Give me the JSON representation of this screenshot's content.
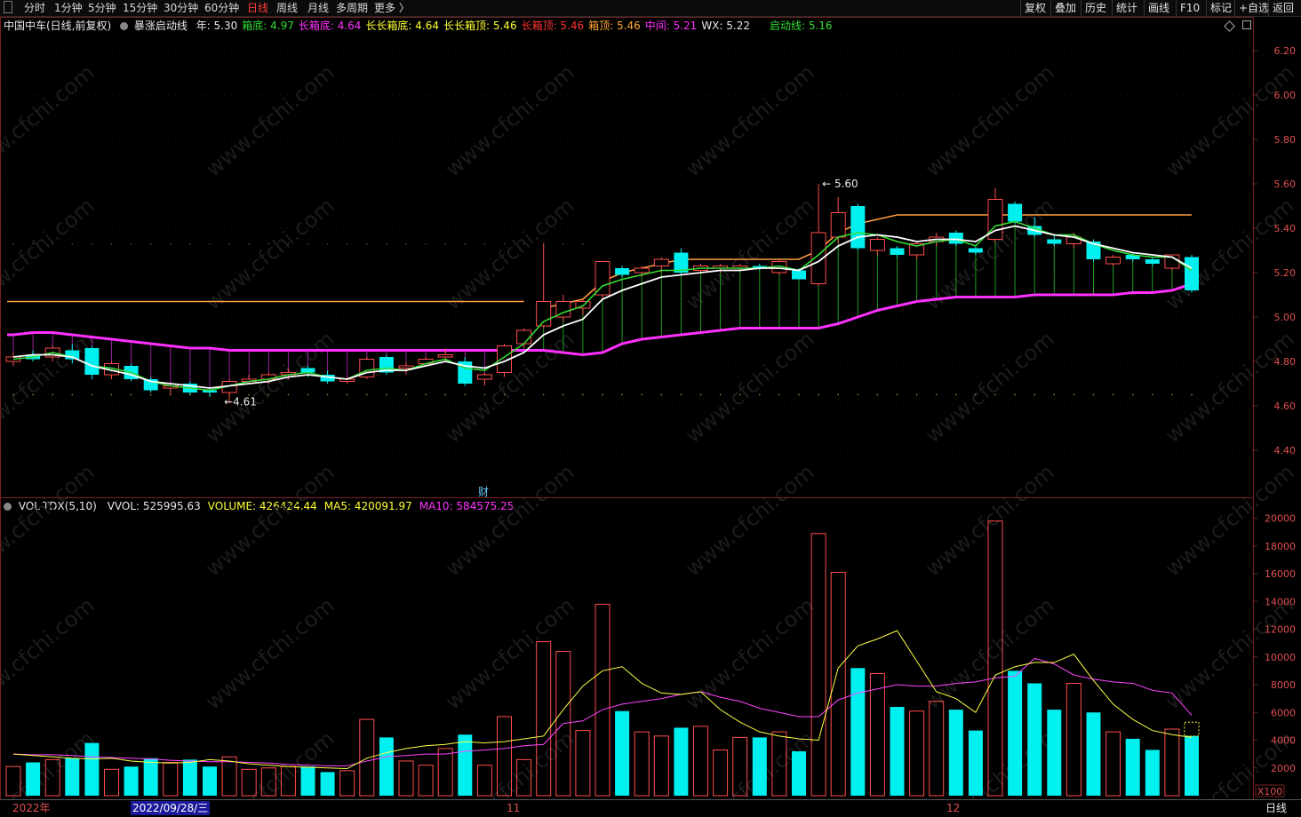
{
  "toolbar": {
    "periods": [
      "分时",
      "1分钟",
      "5分钟",
      "15分钟",
      "30分钟",
      "60分钟",
      "日线",
      "周线",
      "月线",
      "多周期",
      "更多 〉"
    ],
    "active_period": "日线",
    "right_buttons": [
      "复权",
      "叠加",
      "历史",
      "统计",
      "画线",
      "F10",
      "标记",
      "+自选",
      "返回"
    ]
  },
  "main_legend": {
    "title": "中国中车(日线,前复权)",
    "indicator": "暴涨启动线",
    "items": [
      {
        "label": "年: 5.30",
        "color": "#e8e8e8"
      },
      {
        "label": "箱底: 4.97",
        "color": "#33dd33"
      },
      {
        "label": "长箱底: 4.64",
        "color": "#ff33ff"
      },
      {
        "label": "长长箱底: 4.64",
        "color": "#ffff33"
      },
      {
        "label": "长长箱顶: 5.46",
        "color": "#ffff33"
      },
      {
        "label": "长箱顶: 5.46",
        "color": "#ff3333"
      },
      {
        "label": "箱顶: 5.46",
        "color": "#ffaa33"
      },
      {
        "label": "中间: 5.21",
        "color": "#ff33ff"
      },
      {
        "label": "WX: 5.22",
        "color": "#e8e8e8"
      },
      {
        "label": "启动线: 5.16",
        "color": "#33dd33"
      }
    ]
  },
  "vol_legend": {
    "title": "VOL-TDX(5,10)",
    "items": [
      {
        "label": "VVOL: 525995.63",
        "color": "#e8e8e8"
      },
      {
        "label": "VOLUME: 426424.44",
        "color": "#ffff33"
      },
      {
        "label": "MA5: 420091.97",
        "color": "#ffff33"
      },
      {
        "label": "MA10: 584575.25",
        "color": "#ff33ff"
      }
    ]
  },
  "price_axis": [
    "6.20",
    "6.00",
    "5.80",
    "5.60",
    "5.40",
    "5.20",
    "5.00",
    "4.80",
    "4.60",
    "4.40"
  ],
  "vol_axis": [
    "20000",
    "18000",
    "16000",
    "14000",
    "12000",
    "10000",
    "8000",
    "6000",
    "4000",
    "2000"
  ],
  "vol_unit": "X100",
  "annotations": {
    "high": "5.60",
    "low": "4.61",
    "event": "财"
  },
  "dates": {
    "year": "2022年",
    "cursor": "2022/09/28/三",
    "nov": "11",
    "dec": "12"
  },
  "status_period": "日线",
  "watermark": "www.cfchi.com",
  "colors": {
    "up": "#ff4d4d",
    "down": "#00f0f0",
    "ma5": "#ffff44",
    "ma10": "#ff44ff"
  },
  "chart_data": {
    "type": "candlestick",
    "price_range": [
      4.3,
      6.3
    ],
    "volume_range": [
      0,
      21000
    ],
    "candles": [
      {
        "o": 4.8,
        "h": 4.84,
        "l": 4.78,
        "c": 4.82,
        "v": 2100
      },
      {
        "o": 4.83,
        "h": 4.85,
        "l": 4.8,
        "c": 4.81,
        "v": 2400
      },
      {
        "o": 4.82,
        "h": 4.87,
        "l": 4.8,
        "c": 4.86,
        "v": 2600
      },
      {
        "o": 4.85,
        "h": 4.88,
        "l": 4.79,
        "c": 4.81,
        "v": 2700
      },
      {
        "o": 4.86,
        "h": 4.87,
        "l": 4.72,
        "c": 4.74,
        "v": 3800
      },
      {
        "o": 4.74,
        "h": 4.8,
        "l": 4.72,
        "c": 4.79,
        "v": 1900
      },
      {
        "o": 4.78,
        "h": 4.79,
        "l": 4.71,
        "c": 4.72,
        "v": 2100
      },
      {
        "o": 4.72,
        "h": 4.73,
        "l": 4.66,
        "c": 4.67,
        "v": 2700
      },
      {
        "o": 4.68,
        "h": 4.7,
        "l": 4.65,
        "c": 4.69,
        "v": 2400
      },
      {
        "o": 4.7,
        "h": 4.71,
        "l": 4.65,
        "c": 4.66,
        "v": 2600
      },
      {
        "o": 4.67,
        "h": 4.68,
        "l": 4.64,
        "c": 4.66,
        "v": 2100
      },
      {
        "o": 4.66,
        "h": 4.72,
        "l": 4.61,
        "c": 4.71,
        "v": 2800
      },
      {
        "o": 4.71,
        "h": 4.74,
        "l": 4.7,
        "c": 4.72,
        "v": 1900
      },
      {
        "o": 4.72,
        "h": 4.75,
        "l": 4.7,
        "c": 4.74,
        "v": 2000
      },
      {
        "o": 4.74,
        "h": 4.77,
        "l": 4.72,
        "c": 4.75,
        "v": 2100
      },
      {
        "o": 4.77,
        "h": 4.78,
        "l": 4.73,
        "c": 4.75,
        "v": 2100
      },
      {
        "o": 4.74,
        "h": 4.76,
        "l": 4.7,
        "c": 4.71,
        "v": 1700
      },
      {
        "o": 4.71,
        "h": 4.73,
        "l": 4.7,
        "c": 4.72,
        "v": 1800
      },
      {
        "o": 4.73,
        "h": 4.82,
        "l": 4.72,
        "c": 4.81,
        "v": 5500
      },
      {
        "o": 4.82,
        "h": 4.83,
        "l": 4.74,
        "c": 4.75,
        "v": 4200
      },
      {
        "o": 4.77,
        "h": 4.8,
        "l": 4.74,
        "c": 4.78,
        "v": 2500
      },
      {
        "o": 4.79,
        "h": 4.82,
        "l": 4.78,
        "c": 4.81,
        "v": 2200
      },
      {
        "o": 4.82,
        "h": 4.86,
        "l": 4.8,
        "c": 4.83,
        "v": 3400
      },
      {
        "o": 4.8,
        "h": 4.82,
        "l": 4.69,
        "c": 4.7,
        "v": 4400
      },
      {
        "o": 4.72,
        "h": 4.75,
        "l": 4.69,
        "c": 4.74,
        "v": 2200
      },
      {
        "o": 4.75,
        "h": 4.88,
        "l": 4.73,
        "c": 4.87,
        "v": 5700
      },
      {
        "o": 4.88,
        "h": 4.95,
        "l": 4.86,
        "c": 4.94,
        "v": 2600
      },
      {
        "o": 4.96,
        "h": 5.33,
        "l": 4.95,
        "c": 5.07,
        "v": 11100
      },
      {
        "o": 5.0,
        "h": 5.1,
        "l": 4.98,
        "c": 5.07,
        "v": 10400
      },
      {
        "o": 5.04,
        "h": 5.08,
        "l": 5.01,
        "c": 5.07,
        "v": 4700
      },
      {
        "o": 5.1,
        "h": 5.25,
        "l": 5.08,
        "c": 5.25,
        "v": 13800
      },
      {
        "o": 5.22,
        "h": 5.23,
        "l": 5.18,
        "c": 5.19,
        "v": 6100
      },
      {
        "o": 5.2,
        "h": 5.23,
        "l": 5.18,
        "c": 5.22,
        "v": 4600
      },
      {
        "o": 5.23,
        "h": 5.27,
        "l": 5.2,
        "c": 5.26,
        "v": 4300
      },
      {
        "o": 5.29,
        "h": 5.31,
        "l": 5.19,
        "c": 5.2,
        "v": 4900
      },
      {
        "o": 5.21,
        "h": 5.24,
        "l": 5.2,
        "c": 5.23,
        "v": 5000
      },
      {
        "o": 5.22,
        "h": 5.24,
        "l": 5.2,
        "c": 5.23,
        "v": 3300
      },
      {
        "o": 5.22,
        "h": 5.24,
        "l": 5.21,
        "c": 5.23,
        "v": 4200
      },
      {
        "o": 5.23,
        "h": 5.24,
        "l": 5.21,
        "c": 5.22,
        "v": 4200
      },
      {
        "o": 5.2,
        "h": 5.26,
        "l": 5.19,
        "c": 5.25,
        "v": 4600
      },
      {
        "o": 5.21,
        "h": 5.22,
        "l": 5.17,
        "c": 5.17,
        "v": 3200
      },
      {
        "o": 5.15,
        "h": 5.6,
        "l": 5.14,
        "c": 5.38,
        "v": 18900
      },
      {
        "o": 5.36,
        "h": 5.54,
        "l": 5.33,
        "c": 5.47,
        "v": 16100
      },
      {
        "o": 5.5,
        "h": 5.51,
        "l": 5.3,
        "c": 5.31,
        "v": 9200
      },
      {
        "o": 5.3,
        "h": 5.36,
        "l": 5.28,
        "c": 5.35,
        "v": 8800
      },
      {
        "o": 5.31,
        "h": 5.32,
        "l": 5.27,
        "c": 5.28,
        "v": 6400
      },
      {
        "o": 5.28,
        "h": 5.34,
        "l": 5.26,
        "c": 5.33,
        "v": 6100
      },
      {
        "o": 5.34,
        "h": 5.38,
        "l": 5.32,
        "c": 5.36,
        "v": 6800
      },
      {
        "o": 5.38,
        "h": 5.39,
        "l": 5.32,
        "c": 5.33,
        "v": 6200
      },
      {
        "o": 5.31,
        "h": 5.32,
        "l": 5.28,
        "c": 5.29,
        "v": 4700
      },
      {
        "o": 5.35,
        "h": 5.58,
        "l": 5.34,
        "c": 5.53,
        "v": 19800
      },
      {
        "o": 5.51,
        "h": 5.52,
        "l": 5.42,
        "c": 5.43,
        "v": 9000
      },
      {
        "o": 5.41,
        "h": 5.45,
        "l": 5.36,
        "c": 5.37,
        "v": 8100
      },
      {
        "o": 5.35,
        "h": 5.37,
        "l": 5.32,
        "c": 5.33,
        "v": 6200
      },
      {
        "o": 5.33,
        "h": 5.38,
        "l": 5.31,
        "c": 5.36,
        "v": 8100
      },
      {
        "o": 5.34,
        "h": 5.35,
        "l": 5.25,
        "c": 5.26,
        "v": 6000
      },
      {
        "o": 5.24,
        "h": 5.28,
        "l": 5.23,
        "c": 5.27,
        "v": 4600
      },
      {
        "o": 5.28,
        "h": 5.29,
        "l": 5.25,
        "c": 5.26,
        "v": 4100
      },
      {
        "o": 5.26,
        "h": 5.27,
        "l": 5.23,
        "c": 5.24,
        "v": 3300
      },
      {
        "o": 5.22,
        "h": 5.28,
        "l": 5.21,
        "c": 5.28,
        "v": 4800
      },
      {
        "o": 5.27,
        "h": 5.28,
        "l": 5.11,
        "c": 5.12,
        "v": 4300
      }
    ],
    "wx_line": [
      4.82,
      4.83,
      4.83,
      4.82,
      4.78,
      4.76,
      4.74,
      4.71,
      4.7,
      4.69,
      4.68,
      4.69,
      4.7,
      4.71,
      4.73,
      4.74,
      4.73,
      4.72,
      4.75,
      4.76,
      4.76,
      4.78,
      4.8,
      4.78,
      4.77,
      4.8,
      4.84,
      4.92,
      4.96,
      4.99,
      5.08,
      5.12,
      5.15,
      5.18,
      5.19,
      5.2,
      5.21,
      5.21,
      5.22,
      5.22,
      5.21,
      5.25,
      5.32,
      5.36,
      5.37,
      5.36,
      5.34,
      5.35,
      5.35,
      5.34,
      5.39,
      5.41,
      5.39,
      5.37,
      5.36,
      5.33,
      5.31,
      5.29,
      5.28,
      5.27,
      5.22
    ],
    "green_line": [
      4.81,
      4.82,
      4.84,
      4.82,
      4.78,
      4.77,
      4.75,
      4.71,
      4.69,
      4.68,
      4.67,
      4.69,
      4.71,
      4.72,
      4.74,
      4.75,
      4.73,
      4.72,
      4.76,
      4.77,
      4.76,
      4.79,
      4.81,
      4.77,
      4.76,
      4.82,
      4.88,
      4.98,
      5.02,
      5.05,
      5.14,
      5.17,
      5.19,
      5.21,
      5.21,
      5.22,
      5.22,
      5.22,
      5.22,
      5.23,
      5.21,
      5.28,
      5.36,
      5.38,
      5.37,
      5.34,
      5.32,
      5.34,
      5.35,
      5.32,
      5.41,
      5.43,
      5.4,
      5.37,
      5.37,
      5.33,
      5.3,
      5.28,
      5.27,
      5.27,
      5.21
    ],
    "orange_line": [
      null,
      null,
      null,
      null,
      null,
      null,
      null,
      null,
      null,
      null,
      null,
      null,
      null,
      null,
      null,
      null,
      null,
      null,
      null,
      null,
      null,
      null,
      null,
      null,
      null,
      null,
      null,
      5.04,
      5.06,
      5.08,
      5.16,
      5.2,
      5.22,
      5.24,
      5.26,
      5.26,
      5.26,
      5.26,
      5.26,
      5.26,
      5.26,
      5.3,
      5.38,
      5.42,
      5.44,
      5.46,
      5.46,
      5.46,
      5.46,
      5.46,
      5.46,
      5.46,
      5.46,
      5.46,
      5.46,
      5.46,
      5.46,
      5.46,
      5.46,
      5.46,
      5.46
    ],
    "orange_flat": {
      "value": 5.07,
      "from": 0,
      "to": 26
    },
    "magenta_line": [
      4.92,
      4.93,
      4.93,
      4.92,
      4.91,
      4.9,
      4.89,
      4.88,
      4.87,
      4.86,
      4.86,
      4.85,
      4.85,
      4.85,
      4.85,
      4.85,
      4.85,
      4.85,
      4.85,
      4.85,
      4.85,
      4.85,
      4.85,
      4.85,
      4.85,
      4.85,
      4.85,
      4.85,
      4.84,
      4.83,
      4.84,
      4.88,
      4.9,
      4.91,
      4.92,
      4.93,
      4.94,
      4.95,
      4.95,
      4.95,
      4.95,
      4.95,
      4.97,
      5.0,
      5.03,
      5.05,
      5.07,
      5.08,
      5.09,
      5.09,
      5.09,
      5.09,
      5.1,
      5.1,
      5.1,
      5.1,
      5.1,
      5.11,
      5.11,
      5.12,
      5.15,
      5.2
    ],
    "ma5_vol": [
      3000,
      2900,
      2800,
      2700,
      2650,
      2700,
      2500,
      2400,
      2350,
      2400,
      2600,
      2500,
      2300,
      2200,
      2100,
      2050,
      2000,
      1950,
      2700,
      3100,
      3400,
      3600,
      3700,
      3900,
      3800,
      3900,
      4100,
      4300,
      6200,
      7900,
      9000,
      9300,
      8100,
      7400,
      7300,
      7500,
      6200,
      5300,
      4600,
      4300,
      4100,
      4000,
      9200,
      10800,
      11300,
      11900,
      9700,
      7500,
      7000,
      6000,
      8700,
      9300,
      9600,
      9600,
      10200,
      8300,
      6600,
      5500,
      4700,
      4400,
      4200
    ],
    "ma10_vol": [
      3000,
      2950,
      2950,
      2900,
      2800,
      2750,
      2700,
      2650,
      2550,
      2500,
      2450,
      2450,
      2400,
      2350,
      2250,
      2200,
      2150,
      2150,
      2500,
      2800,
      2900,
      3000,
      3000,
      3200,
      3300,
      3400,
      3600,
      3700,
      5200,
      5400,
      6200,
      6600,
      6800,
      7000,
      7300,
      7500,
      7100,
      6800,
      6300,
      6000,
      5700,
      5700,
      6900,
      7400,
      7700,
      8000,
      7900,
      7900,
      8100,
      8200,
      8500,
      8600,
      9900,
      9500,
      8700,
      8400,
      8200,
      8100,
      7600,
      7400,
      5800
    ]
  }
}
